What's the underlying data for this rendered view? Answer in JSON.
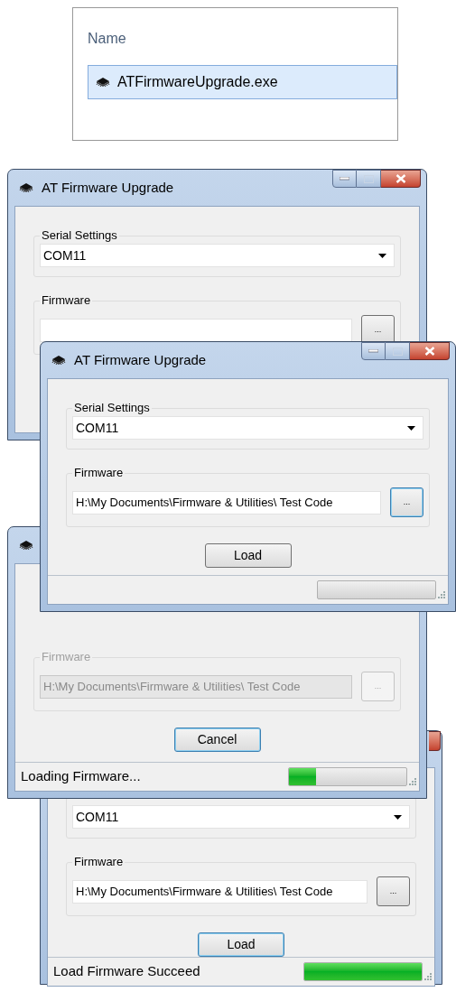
{
  "file_list": {
    "column_header": "Name",
    "items": [
      {
        "name": "ATFirmwareUpgrade.exe",
        "selected": true
      }
    ]
  },
  "windows": [
    {
      "title": "AT Firmware Upgrade",
      "serial_settings": {
        "label": "Serial Settings",
        "port": "COM11"
      },
      "firmware": {
        "label": "Firmware",
        "disabled": false
      },
      "browse": {
        "label": "...",
        "focused": false
      }
    },
    {
      "title": "AT Firmware Upgrade",
      "serial_settings": {
        "label": "Serial Settings",
        "port": "COM11"
      },
      "firmware": {
        "label": "Firmware",
        "path": "H:\\My Documents\\Firmware & Utilities\\ Test Code",
        "disabled": false
      },
      "browse": {
        "label": "...",
        "focused": true
      },
      "action": {
        "label": "Load",
        "focused": false
      },
      "status": {
        "level": 0
      }
    },
    {
      "firmware": {
        "label": "Firmware",
        "path": "H:\\My Documents\\Firmware & Utilities\\ Test Code",
        "disabled": true
      },
      "browse": {
        "label": "...",
        "focused": false
      },
      "action": {
        "label": "Cancel",
        "focused": true
      },
      "status": {
        "text": "Loading Firmware...",
        "level": 0.23
      }
    },
    {
      "serial_settings": {
        "port": "COM11"
      },
      "firmware": {
        "label": "Firmware",
        "path": "H:\\My Documents\\Firmware & Utilities\\ Test Code",
        "disabled": false
      },
      "browse": {
        "label": "...",
        "focused": false
      },
      "action": {
        "label": "Load",
        "focused": true
      },
      "status": {
        "text": "Load Firmware Succeed",
        "level": 1
      }
    }
  ]
}
